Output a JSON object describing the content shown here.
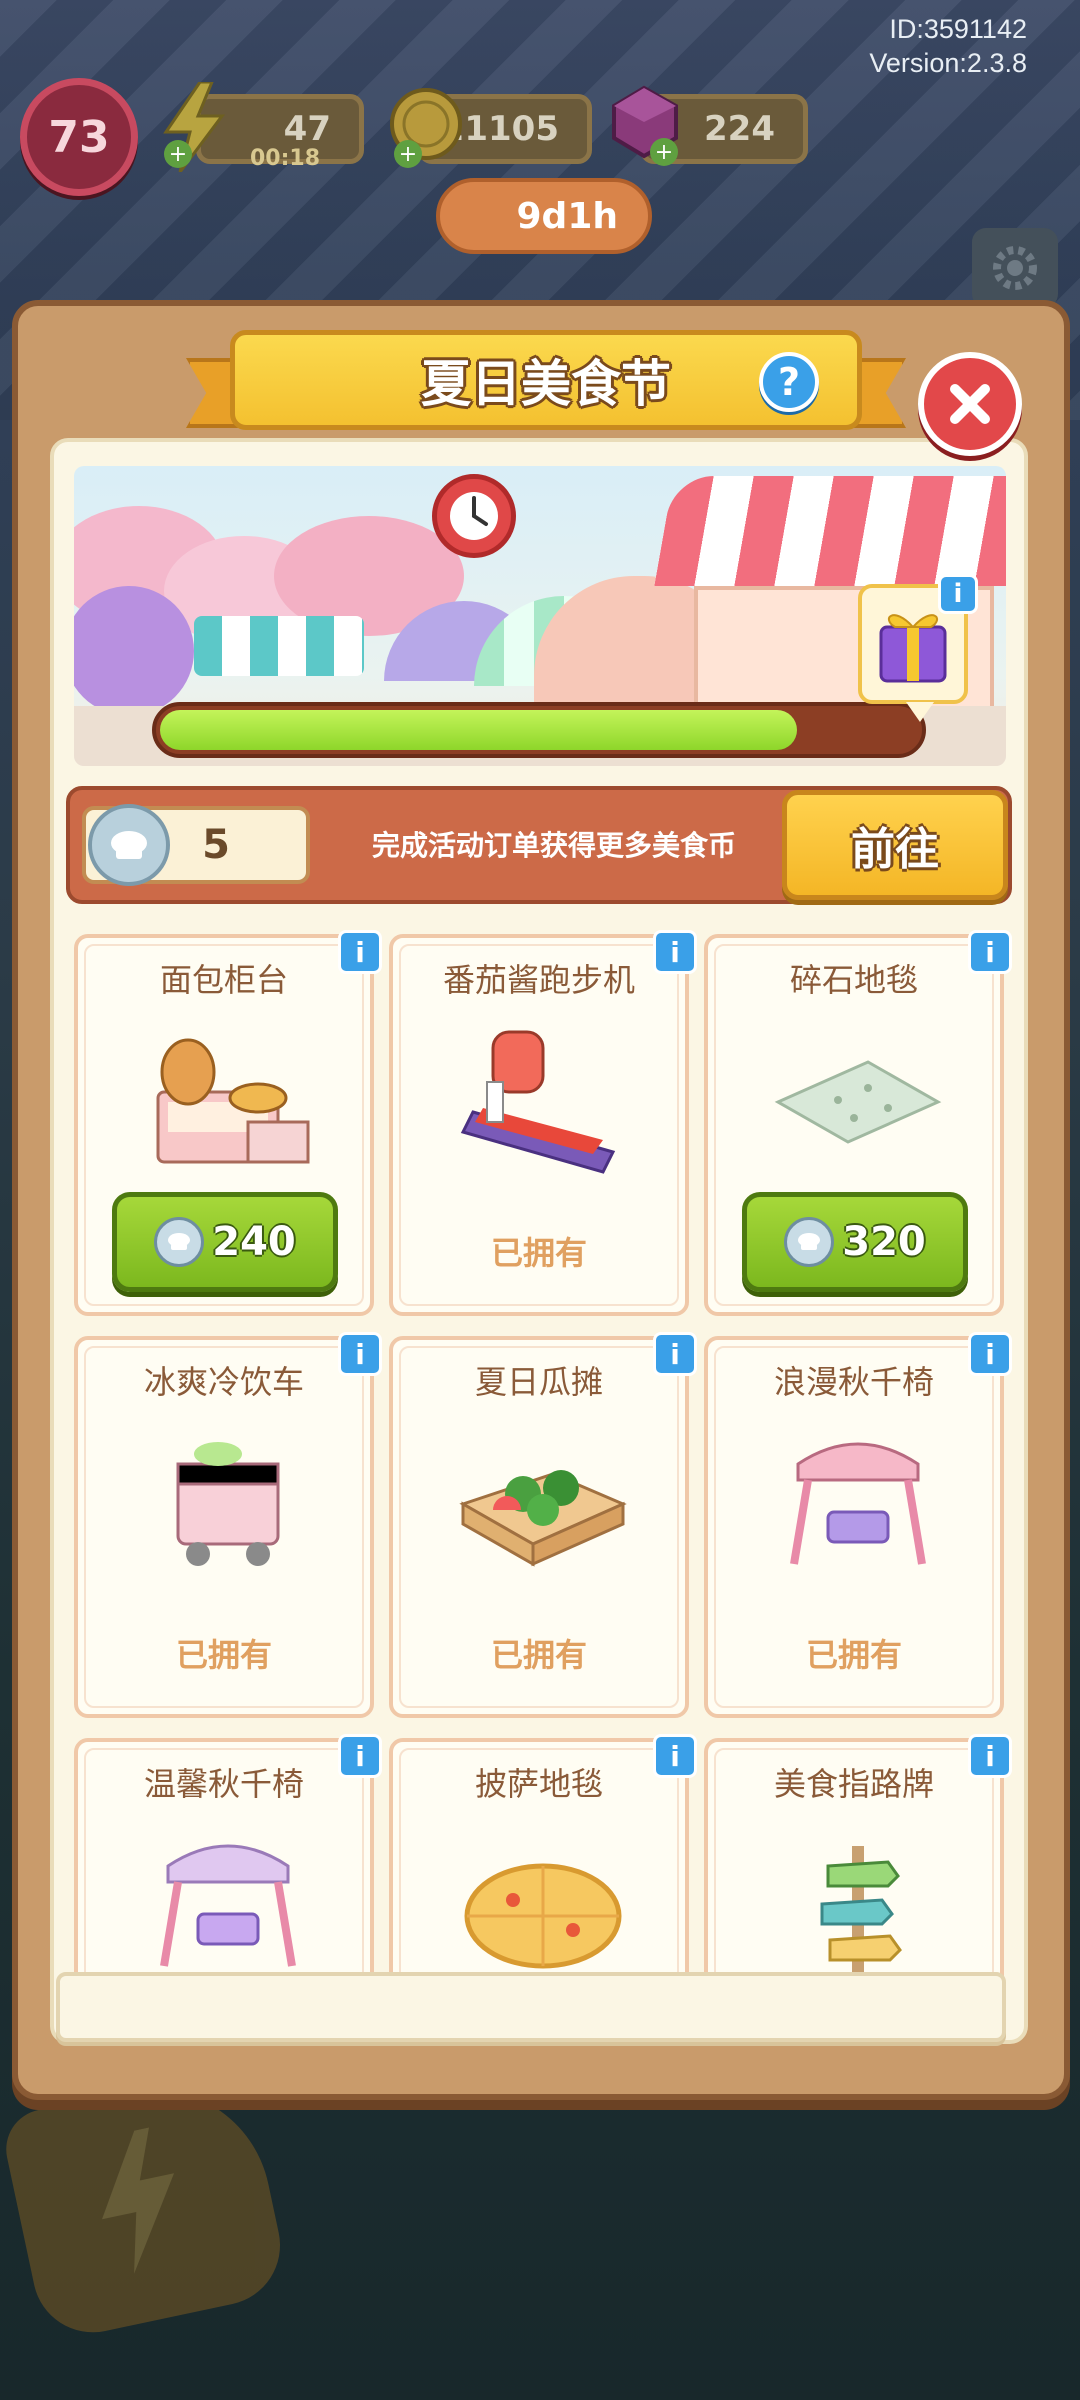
{
  "header": {
    "id_text": "ID:3591142",
    "version_text": "Version:2.3.8",
    "level": "73",
    "energy": "47",
    "energy_timer": "00:18",
    "coins": "21105",
    "gems": "224"
  },
  "modal": {
    "title": "夏日美食节",
    "help_icon": "?",
    "timer": "9d1h",
    "progress": 0.84,
    "coin_balance": "5",
    "coin_description": "完成活动订单获得更多美食币",
    "go_button": "前往",
    "info_icon": "i"
  },
  "items": [
    {
      "name": "面包柜台",
      "status": "price",
      "price": "240"
    },
    {
      "name": "番茄酱跑步机",
      "status": "owned",
      "owned_label": "已拥有"
    },
    {
      "name": "碎石地毯",
      "status": "price",
      "price": "320"
    },
    {
      "name": "冰爽冷饮车",
      "status": "owned",
      "owned_label": "已拥有"
    },
    {
      "name": "夏日瓜摊",
      "status": "owned",
      "owned_label": "已拥有"
    },
    {
      "name": "浪漫秋千椅",
      "status": "owned",
      "owned_label": "已拥有"
    },
    {
      "name": "温馨秋千椅",
      "status": "partial"
    },
    {
      "name": "披萨地毯",
      "status": "partial"
    },
    {
      "name": "美食指路牌",
      "status": "partial"
    }
  ],
  "colors": {
    "accent_yellow": "#f4c130",
    "close_red": "#e2484a",
    "price_green": "#8ec82a",
    "info_blue": "#3aa0e8"
  }
}
